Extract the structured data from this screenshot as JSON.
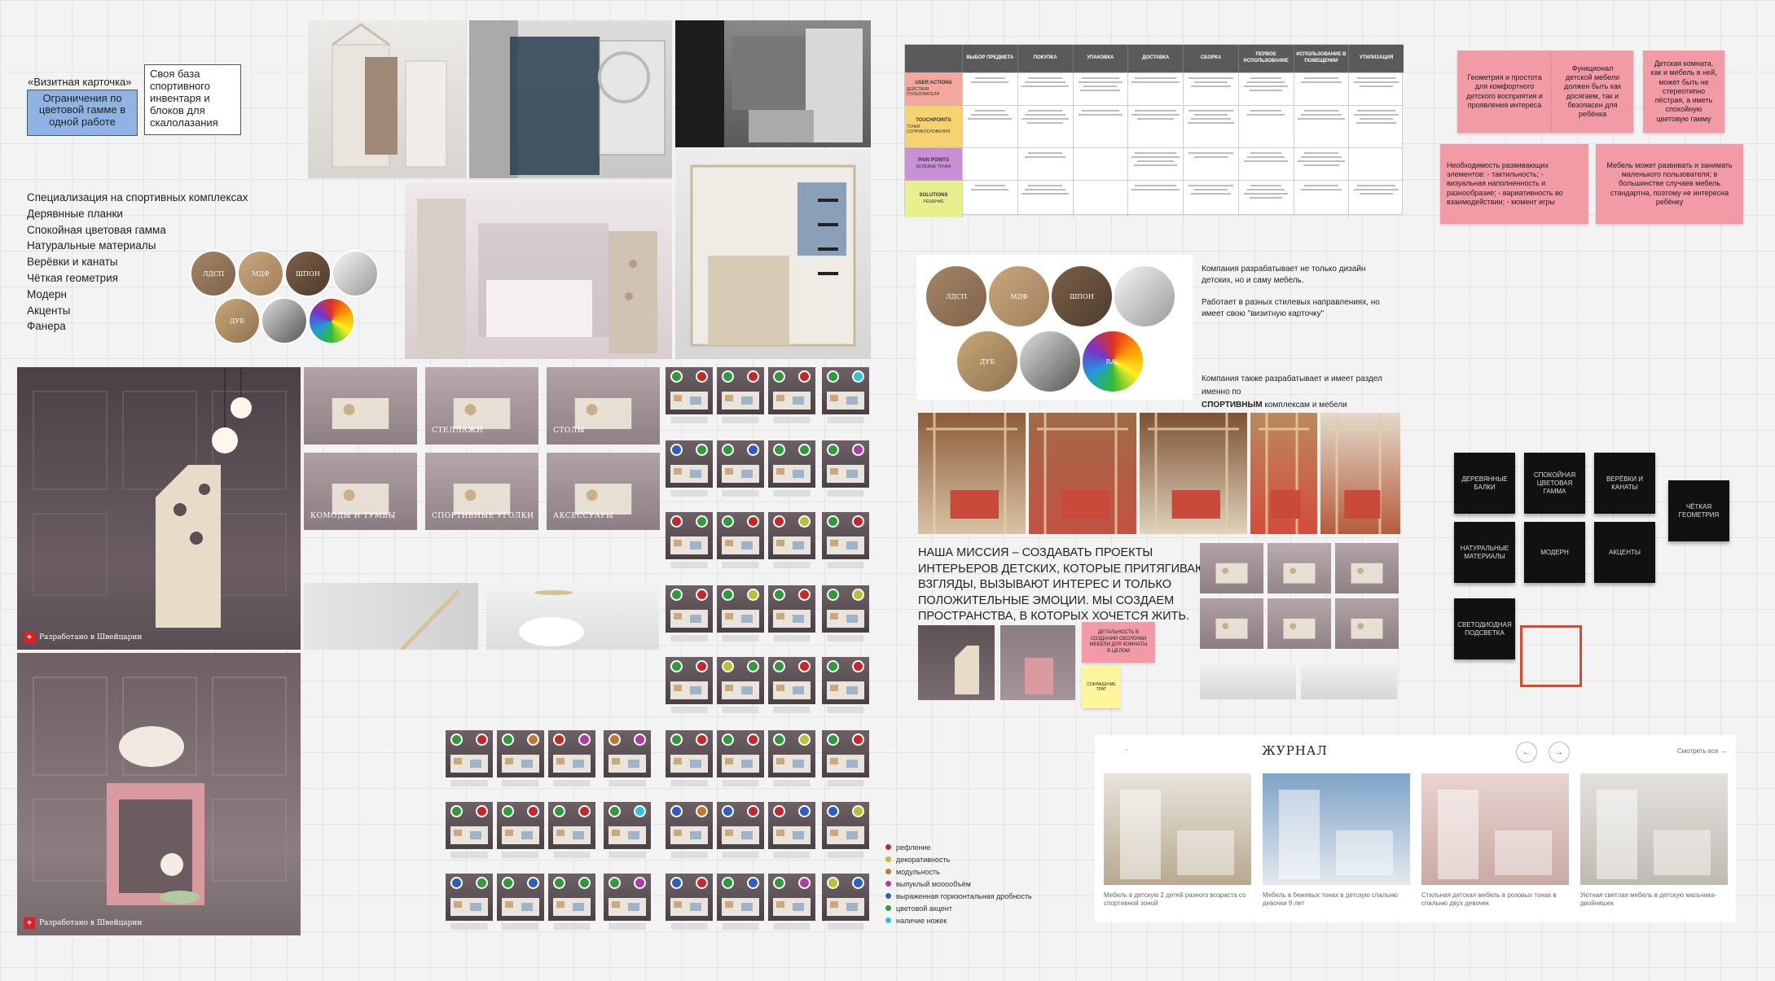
{
  "left_card": {
    "caption": "«Визитная карточка»",
    "blue_box": "Ограничения по цветовой гамме в одной работе",
    "white_box": "Своя база спортивного инвентаря и блоков для скалолазания"
  },
  "features": [
    "Специализация на спортивных комплексах",
    "Дерявнные планки",
    "Спокойная цветовая гамма",
    "Натуральные материалы",
    "Верёвки и канаты",
    "Чёткая геометрия",
    "Модерн",
    "Акценты",
    "Фанера"
  ],
  "swatches_left": [
    "ЛДСП",
    "МДФ",
    "ШПОН",
    "",
    "ДУБ",
    "",
    ""
  ],
  "swatches_right": [
    "ЛДСП",
    "МДФ",
    "ШПОН",
    "",
    "ДУБ",
    "",
    "RAL"
  ],
  "swiss_badge": "Разработано в Швейцарии",
  "catalog_labels": [
    "",
    "СТЕЛЛАЖИ",
    "СТОЛЫ",
    "КОМОДЫ И ТУМБЫ",
    "СПОРТИВНЫЕ УГОЛКИ",
    "АКСЕССУАРЫ"
  ],
  "cjm": {
    "columns": [
      "ВЫБОР ПРЕДМЕТА",
      "ПОКУПКА",
      "УПАКОВКА",
      "ДОСТАВКА",
      "СБОРКА",
      "ПЕРВОЕ ИСПОЛЬЗОВАНИЕ",
      "ИСПОЛЬЗОВАНИЕ В ПОМЕЩЕНИИ",
      "УТИЛИЗАЦИЯ"
    ],
    "rows": [
      {
        "title": "USER ACTIONS",
        "sub": "ДЕЙСТВИЯ ПОЛЬЗОВАТЕЛЯ",
        "color": "#f4a79a"
      },
      {
        "title": "TOUCHPOINTS",
        "sub": "ТОЧКИ СОПРИКОСНОВЕНИЯ",
        "color": "#f6d36f"
      },
      {
        "title": "PAIN POINTS",
        "sub": "БОЛЕВЫЕ ТОЧКИ",
        "color": "#c990d8"
      },
      {
        "title": "SOLUTIONS",
        "sub": "РЕШЕНИЕ",
        "color": "#e8ef8f"
      }
    ]
  },
  "pink_notes": [
    {
      "text": "Геометрия и простота для комфортного детского восприятия и проявления интереса"
    },
    {
      "text": "Функционал детской мебели должен быть как досягаем, так и безопасен для ребёнка"
    },
    {
      "text": "Детская комната, как и мебель в ней, может быть не стереотипно пёстрая, а иметь спокойную цветовую гамму"
    },
    {
      "text": "Необходимость развивающих элементов: - тактильность; - визуальная наполненность и разнообразие; - вариативность во взаимодействии; - момент игры"
    },
    {
      "text": "Мебель может развивать и занимать маленького пользователя; в большинстве случаев мебель стандартна, поэтому не интересна ребёнку"
    }
  ],
  "company_text": {
    "p1": "Компания разрабатывает не только дизайн детских, но и саму мебель.",
    "p2": "Работает в разных стилевых направлениях, но имеет свою \"визитную карточку\"",
    "p3_a": "Компания также разрабатывает и имеет раздел именно по",
    "p3_bold": "СПОРТИВНЫМ",
    "p3_b": "комплексам и мебели"
  },
  "mission": "НАША МИССИЯ – СОЗДАВАТЬ ПРОЕКТЫ ИНТЕРЬЕРОВ ДЕТСКИХ, КОТОРЫЕ ПРИТЯГИВАЮТ ВЗГЛЯДЫ, ВЫЗЫВАЮТ ИНТЕРЕС И ТОЛЬКО ПОЛОЖИТЕЛЬНЫЕ ЭМОЦИИ. МЫ СОЗДАЕМ ПРОСТРАНСТВА, В КОТОРЫХ ХОЧЕТСЯ ЖИТЬ.",
  "small_pink": "ДЕТАЛЬНОСТЬ В СОЗДАНИИ ОБОЛОЧКИ МЕБЕЛИ ДЛЯ КОМНАТЫ В ЦЕЛОМ",
  "small_yellow": "СОКРАЩЕНИЕ ТРАТ",
  "black_notes": [
    "ДЕРЕВЯННЫЕ БАЛКИ",
    "СПОКОЙНАЯ ЦВЕТОВАЯ ГАММА",
    "ВЕРЁВКИ И КАНАТЫ",
    "ЧЁТКАЯ ГЕОМЕТРИЯ",
    "НАТУРАЛЬНЫЕ МАТЕРИАЛЫ",
    "МОДЕРН",
    "АКЦЕНТЫ",
    "СВЕТОДИОДНАЯ ПОДСВЕТКА"
  ],
  "journal": {
    "title": "ЖУРНАЛ",
    "see_all": "Смотреть все",
    "cards": [
      "Мебель в детскую 2 детей разного возраста со спортивной зоной",
      "Мебель в бежевых тонах в детскую спальню девочки 9 лет",
      "Стильная детская мебель в розовых тонах в спальню двух девочек",
      "Уютная светлая мебель в детскую мальчика-двойняшек"
    ]
  },
  "legend": [
    {
      "label": "рефление",
      "color": "#c62828"
    },
    {
      "label": "декоративность",
      "color": "#b8c034"
    },
    {
      "label": "модульность",
      "color": "#c07a28"
    },
    {
      "label": "выпуклый мооообъём",
      "color": "#b03aa8"
    },
    {
      "label": "выраженная горизонтальная дробность",
      "color": "#2c5ec4"
    },
    {
      "label": "цветовой акцент",
      "color": "#2e9a3a"
    },
    {
      "label": "наличие ножек",
      "color": "#2ec4d8"
    }
  ],
  "colors": {
    "accent_red": "#e0462c",
    "note_pink": "#f29aa6",
    "note_yellow": "#fff59d"
  }
}
